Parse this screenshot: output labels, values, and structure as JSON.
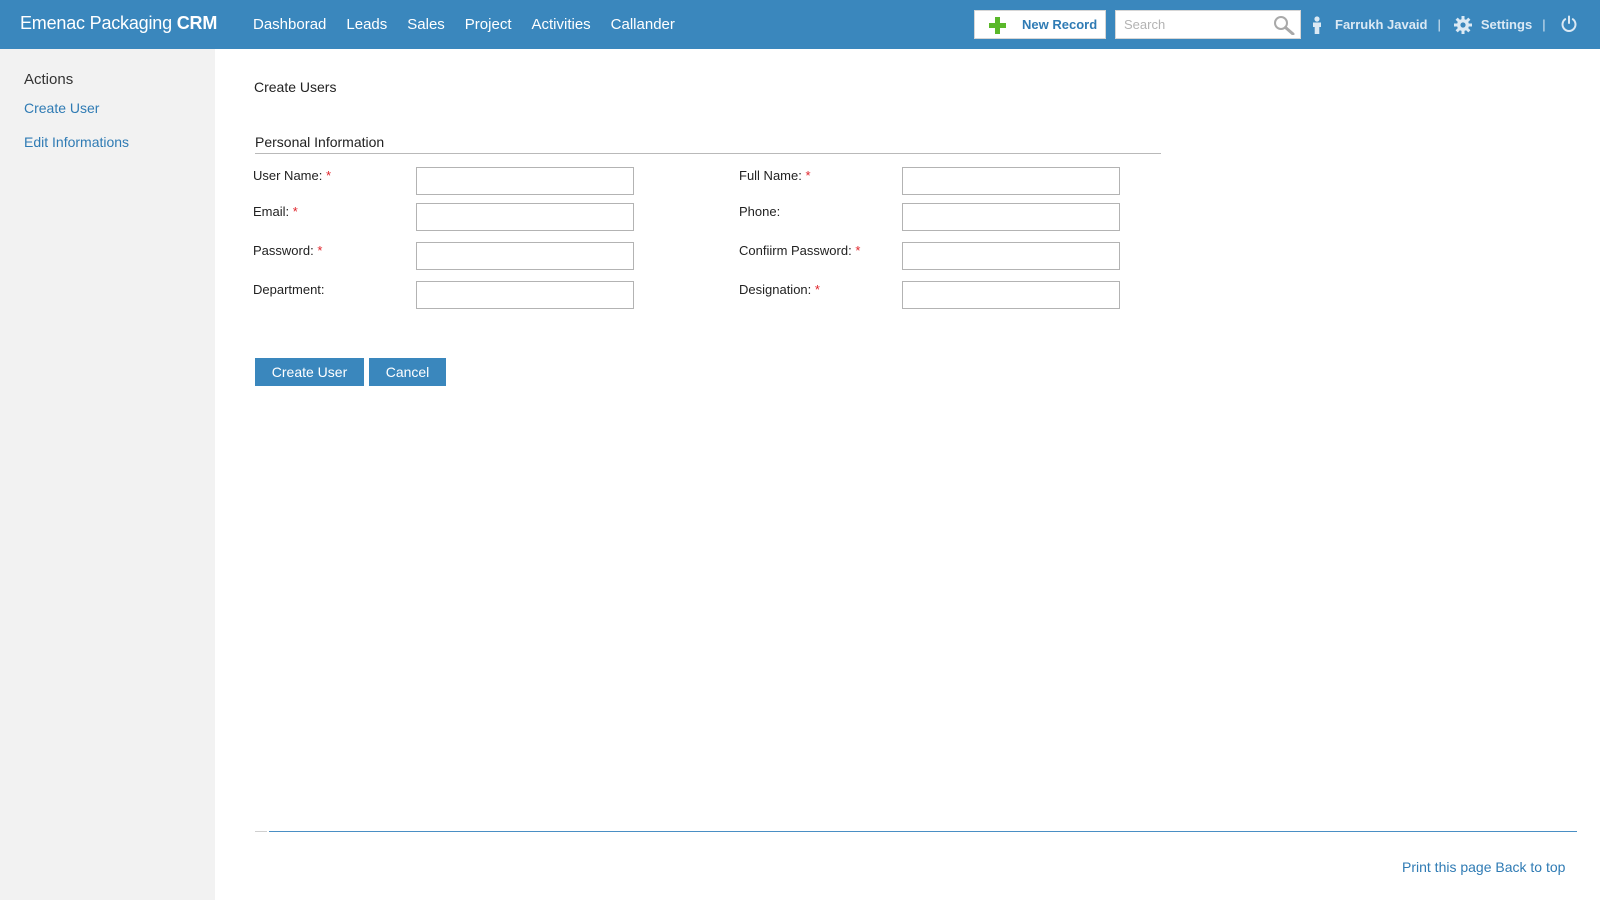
{
  "header": {
    "brand_light": "Emenac Packaging",
    "brand_bold": "CRM",
    "nav": [
      "Dashborad",
      "Leads",
      "Sales",
      "Project",
      "Activities",
      "Callander"
    ],
    "new_record_label": "New Record",
    "search_placeholder": "Search",
    "user_name": "Farrukh Javaid",
    "separator": "|",
    "settings_label": "Settings",
    "accent_color": "#3a87bd",
    "icons": [
      "plus-icon",
      "search-icon",
      "user-icon",
      "gear-icon",
      "power-icon"
    ]
  },
  "sidebar": {
    "title": "Actions",
    "items": [
      "Create User",
      "Edit Informations"
    ]
  },
  "main": {
    "page_title": "Create Users",
    "section_title": "Personal Information",
    "required_marker": "*",
    "fields": {
      "user_name": {
        "label": "User Name:",
        "required": true,
        "value": ""
      },
      "full_name": {
        "label": "Full Name:",
        "required": true,
        "value": ""
      },
      "email": {
        "label": "Email:",
        "required": true,
        "value": ""
      },
      "phone": {
        "label": "Phone:",
        "required": false,
        "value": ""
      },
      "password": {
        "label": "Password:",
        "required": true,
        "value": ""
      },
      "confirm_password": {
        "label": "Confiirm Password:",
        "required": true,
        "value": ""
      },
      "department": {
        "label": "Department:",
        "required": false,
        "value": ""
      },
      "designation": {
        "label": "Designation:",
        "required": true,
        "value": ""
      }
    },
    "buttons": {
      "create": "Create User",
      "cancel": "Cancel"
    }
  },
  "footer": {
    "print": "Print this page",
    "back_to_top": "Back to top"
  }
}
